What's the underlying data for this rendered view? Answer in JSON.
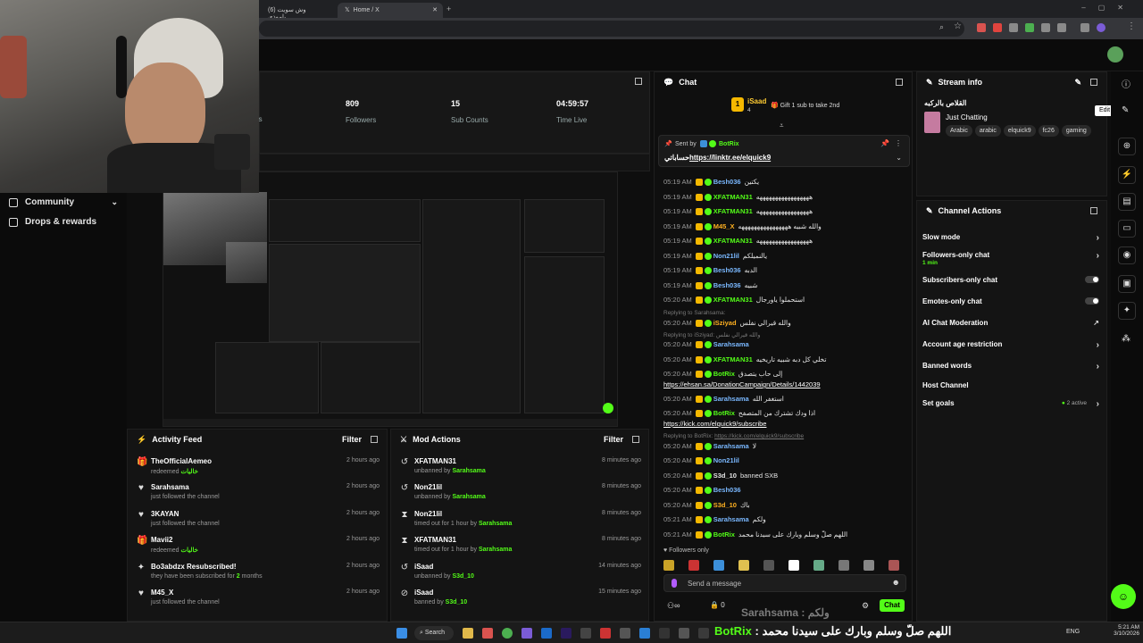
{
  "browser": {
    "tabs": [
      {
        "label": "(6) وش سويت ياموذي",
        "active": false
      },
      {
        "label": "Home / X",
        "active": true
      }
    ]
  },
  "sidebar": {
    "items": [
      {
        "label": "Community"
      },
      {
        "label": "Drops & rewards"
      }
    ]
  },
  "stats": {
    "followers_value": "809",
    "followers_label": "Followers",
    "subs_value": "15",
    "subs_label": "Sub Counts",
    "time_value": "04:59:57",
    "time_label": "Time Live",
    "cut_label": "rs"
  },
  "activity_feed": {
    "title": "Activity Feed",
    "filter_label": "Filter",
    "items": [
      {
        "icon": "gift-icon",
        "name": "TheOfficialAemeo",
        "sub_prefix": "redeemed",
        "sub_highlight": "خاليات",
        "sub_suffix": "",
        "time": "2 hours ago"
      },
      {
        "icon": "heart-icon",
        "name": "Sarahsama",
        "sub_prefix": "just followed the channel",
        "sub_highlight": "",
        "sub_suffix": "",
        "time": "2 hours ago"
      },
      {
        "icon": "heart-icon",
        "name": "3KAYAN",
        "sub_prefix": "just followed the channel",
        "sub_highlight": "",
        "sub_suffix": "",
        "time": "2 hours ago"
      },
      {
        "icon": "gift-icon",
        "name": "Mavii2",
        "sub_prefix": "redeemed",
        "sub_highlight": "خاليات",
        "sub_suffix": "",
        "time": "2 hours ago"
      },
      {
        "icon": "star-icon",
        "name": "Bo3abdzx Resubscribed!",
        "sub_prefix": "they have been subscribed for",
        "sub_highlight": "2",
        "sub_suffix": "months",
        "time": "2 hours ago"
      },
      {
        "icon": "heart-icon",
        "name": "M45_X",
        "sub_prefix": "just followed the channel",
        "sub_highlight": "",
        "sub_suffix": "",
        "time": "2 hours ago"
      }
    ]
  },
  "mod_actions": {
    "title": "Mod Actions",
    "filter_label": "Filter",
    "items": [
      {
        "icon": "undo-icon",
        "name": "XFATMAN31",
        "sub_prefix": "unbanned by",
        "sub_highlight": "Sarahsama",
        "sub_suffix": "",
        "time": "8 minutes ago"
      },
      {
        "icon": "undo-icon",
        "name": "Non21lil",
        "sub_prefix": "unbanned by",
        "sub_highlight": "Sarahsama",
        "sub_suffix": "",
        "time": "8 minutes ago"
      },
      {
        "icon": "hourglass-icon",
        "name": "Non21lil",
        "sub_prefix": "timed out for 1 hour by",
        "sub_highlight": "Sarahsama",
        "sub_suffix": "",
        "time": "8 minutes ago"
      },
      {
        "icon": "hourglass-icon",
        "name": "XFATMAN31",
        "sub_prefix": "timed out for 1 hour by",
        "sub_highlight": "Sarahsama",
        "sub_suffix": "",
        "time": "8 minutes ago"
      },
      {
        "icon": "undo-icon",
        "name": "iSaad",
        "sub_prefix": "unbanned by",
        "sub_highlight": "S3d_10",
        "sub_suffix": "",
        "time": "14 minutes ago"
      },
      {
        "icon": "ban-icon",
        "name": "iSaad",
        "sub_prefix": "banned by",
        "sub_highlight": "S3d_10",
        "sub_suffix": "",
        "time": "15 minutes ago"
      }
    ]
  },
  "chat": {
    "title": "Chat",
    "gifter_name": "iSaad",
    "gifter_count": "4",
    "gift_text": "Gift 1 sub to take 2nd",
    "pinned_by_label": "Sent by",
    "pinned_by_user": "BotRix",
    "pinned_text": "حساباتي",
    "pinned_link": "https://linktr.ee/elquick9",
    "messages": [
      {
        "time": "05:19 AM",
        "user": "Besh036",
        "color": "#7ab8ff",
        "text": "يكتين"
      },
      {
        "time": "05:19 AM",
        "user": "XFATMAN31",
        "color": "#53fc18",
        "text": "هههههههههههههههههه"
      },
      {
        "time": "05:19 AM",
        "user": "XFATMAN31",
        "color": "#53fc18",
        "text": "هههههههههههههههههه"
      },
      {
        "time": "05:19 AM",
        "user": "M45_X",
        "color": "#ffb020",
        "text": "والله شبيه ههههههههههههههههه"
      },
      {
        "time": "05:19 AM",
        "user": "XFATMAN31",
        "color": "#53fc18",
        "text": "هههههههههههههههههه"
      },
      {
        "time": "05:19 AM",
        "user": "Non21lil",
        "color": "#7ab8ff",
        "text": "يالنميلكم"
      },
      {
        "time": "05:19 AM",
        "user": "Besh036",
        "color": "#7ab8ff",
        "text": "الدبه"
      },
      {
        "time": "05:19 AM",
        "user": "Besh036",
        "color": "#7ab8ff",
        "text": "شبيه"
      },
      {
        "time": "05:20 AM",
        "user": "XFATMAN31",
        "color": "#53fc18",
        "text": "استحملوا ياورجال"
      },
      {
        "time": "05:20 AM",
        "user": "iSziyad",
        "color": "#ffb020",
        "text": "والله قيرالي نفلس"
      },
      {
        "time": "05:20 AM",
        "user": "Sarahsama",
        "color": "#7ab8ff",
        "text": ""
      },
      {
        "time": "05:20 AM",
        "user": "XFATMAN31",
        "color": "#53fc18",
        "text": "تخلي كل دبه شبيه تاريخيه"
      },
      {
        "time": "05:20 AM",
        "user": "BotRix",
        "color": "#53fc18",
        "text": "إلى حاب يتصدق"
      },
      {
        "time": "05:20 AM",
        "user": "Sarahsama",
        "color": "#7ab8ff",
        "text": "استغفر الله"
      },
      {
        "time": "05:20 AM",
        "user": "BotRix",
        "color": "#53fc18",
        "text": "اذا ودك تشترك من المتصفح"
      },
      {
        "time": "05:20 AM",
        "user": "Sarahsama",
        "color": "#7ab8ff",
        "text": "لا"
      },
      {
        "time": "05:20 AM",
        "user": "Non21lil",
        "color": "#7ab8ff",
        "text": ""
      },
      {
        "time": "05:20 AM",
        "user": "S3d_10",
        "color": "#e6e6e6",
        "text": "banned SXB"
      },
      {
        "time": "05:20 AM",
        "user": "Besh036",
        "color": "#7ab8ff",
        "text": ""
      },
      {
        "time": "05:20 AM",
        "user": "S3d_10",
        "color": "#ffb020",
        "text": "باك"
      },
      {
        "time": "05:21 AM",
        "user": "Sarahsama",
        "color": "#7ab8ff",
        "text": "ولكم"
      },
      {
        "time": "05:21 AM",
        "user": "BotRix",
        "color": "#53fc18",
        "text": "اللهم صلّ وسلم وبارك على سيدنا محمد"
      }
    ],
    "reply1_label": "Replying to Sarahsama:",
    "reply2_label": "Replying to iSziyad:",
    "reply2_text": "والله قيرالي نفلس",
    "reply3_label": "Replying to BotRix:",
    "reply3_link": "https://kick.com/elquick9/subscribe",
    "link1": "https://ehsan.sa/DonationCampaign/Details/1442039",
    "link2": "https://kick.com/elquick9/subscribe",
    "followers_only": "Followers only",
    "send_placeholder": "Send a message",
    "chat_button": "Chat",
    "footer_count": "0"
  },
  "stream_info": {
    "title": "Stream info",
    "stream_title": "القلاص بالركبه",
    "category": "Just Chatting",
    "tags": [
      "Arabic",
      "arabic",
      "elquick9",
      "fc26",
      "gaming"
    ],
    "edit_tooltip": "Edit"
  },
  "channel_actions": {
    "title": "Channel Actions",
    "items": [
      {
        "label": "Slow mode",
        "sub": "",
        "control": "chevron"
      },
      {
        "label": "Followers-only chat",
        "sub": "1 min",
        "control": "chevron"
      },
      {
        "label": "Subscribers-only chat",
        "sub": "",
        "control": "toggle"
      },
      {
        "label": "Emotes-only chat",
        "sub": "",
        "control": "toggle"
      },
      {
        "label": "AI Chat Moderation",
        "sub": "",
        "control": "external"
      },
      {
        "label": "Account age restriction",
        "sub": "",
        "control": "chevron"
      },
      {
        "label": "Banned words",
        "sub": "",
        "control": "chevron"
      },
      {
        "label": "Host Channel",
        "sub": "",
        "control": "none"
      },
      {
        "label": "Set goals",
        "sub": "",
        "control": "chevron",
        "status": "2 active"
      }
    ]
  },
  "taskbar": {
    "search_label": "Search",
    "overlay_user": "BotRix",
    "overlay_text": "اللهم صلّ وسلم وبارك على سيدنا محمد",
    "overlay_reply": "Sarahsama : ولكم",
    "lang": "ENG",
    "time": "5:21 AM",
    "date": "3/10/2026"
  },
  "colors": {
    "accent": "#53fc18",
    "background": "#0e0e0e",
    "panel": "#141414"
  }
}
